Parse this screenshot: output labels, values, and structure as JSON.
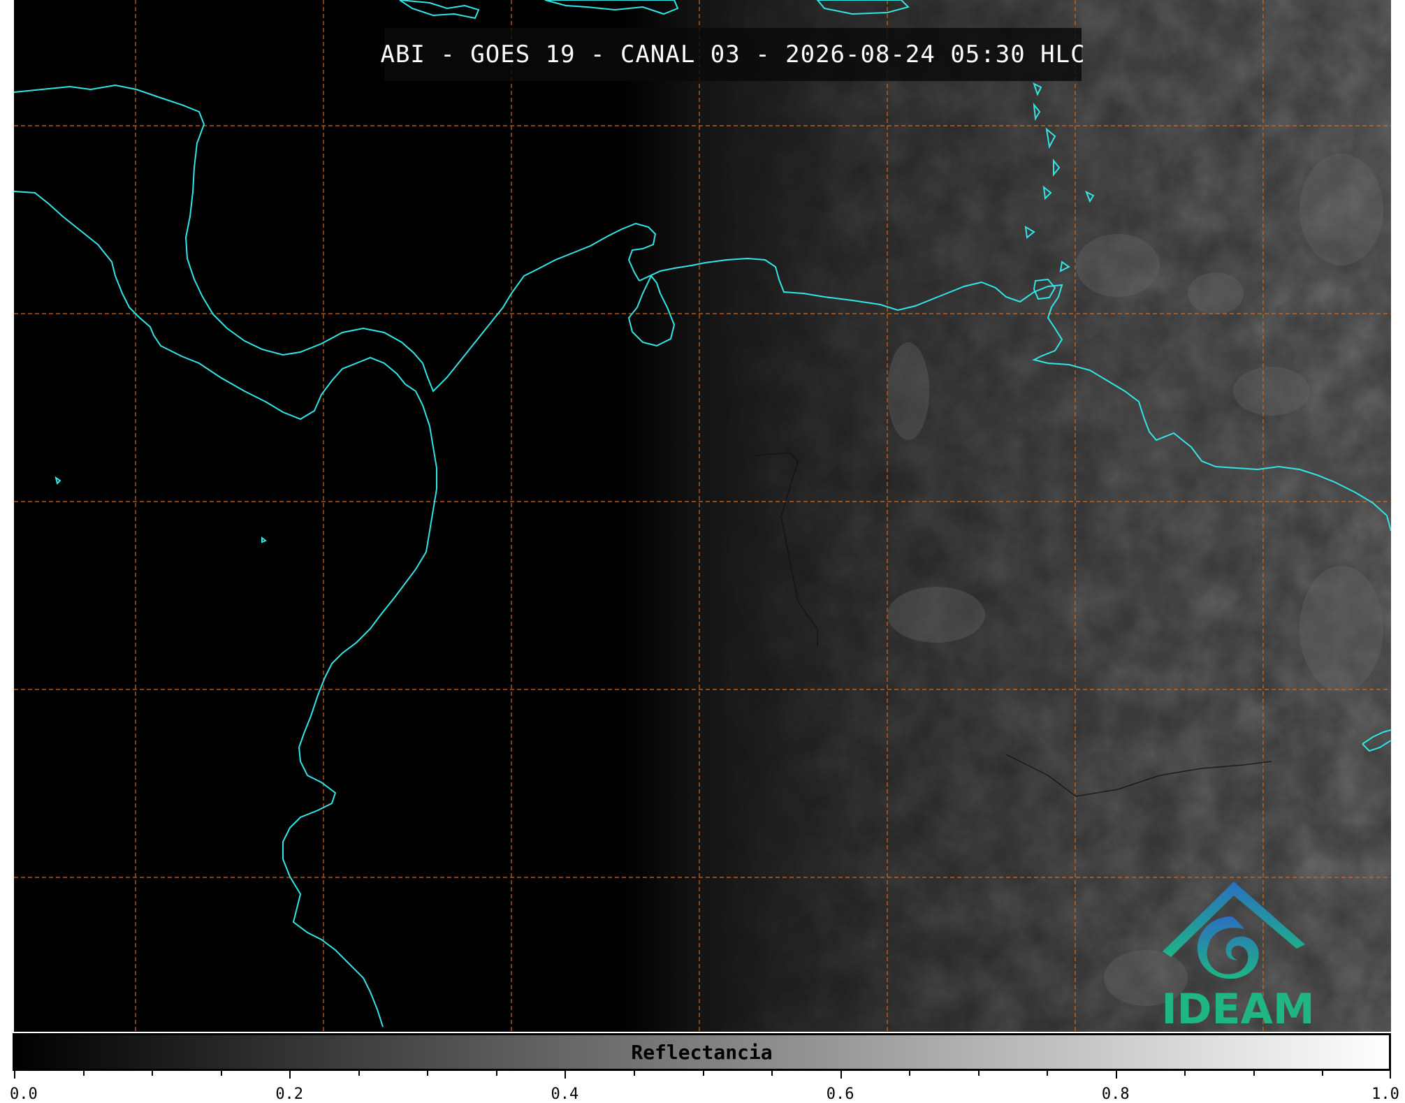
{
  "map": {
    "title": "ABI - GOES 19 - CANAL 03 - 2026-08-24 05:30 HLC",
    "gridline_color": "#d2691e",
    "coastline_color": "#33e6e6",
    "day_night_terminator": "partial"
  },
  "logo": {
    "text": "IDEAM",
    "color": "#1fb584",
    "icon": "ideam-logo-icon"
  },
  "colorbar": {
    "label": "Reflectancia",
    "range": [
      0.0,
      1.0
    ],
    "colormap": "grayscale",
    "major_ticks": [
      "0.0",
      "0.2",
      "0.4",
      "0.6",
      "0.8",
      "1.0"
    ],
    "minor_step": 0.05
  }
}
